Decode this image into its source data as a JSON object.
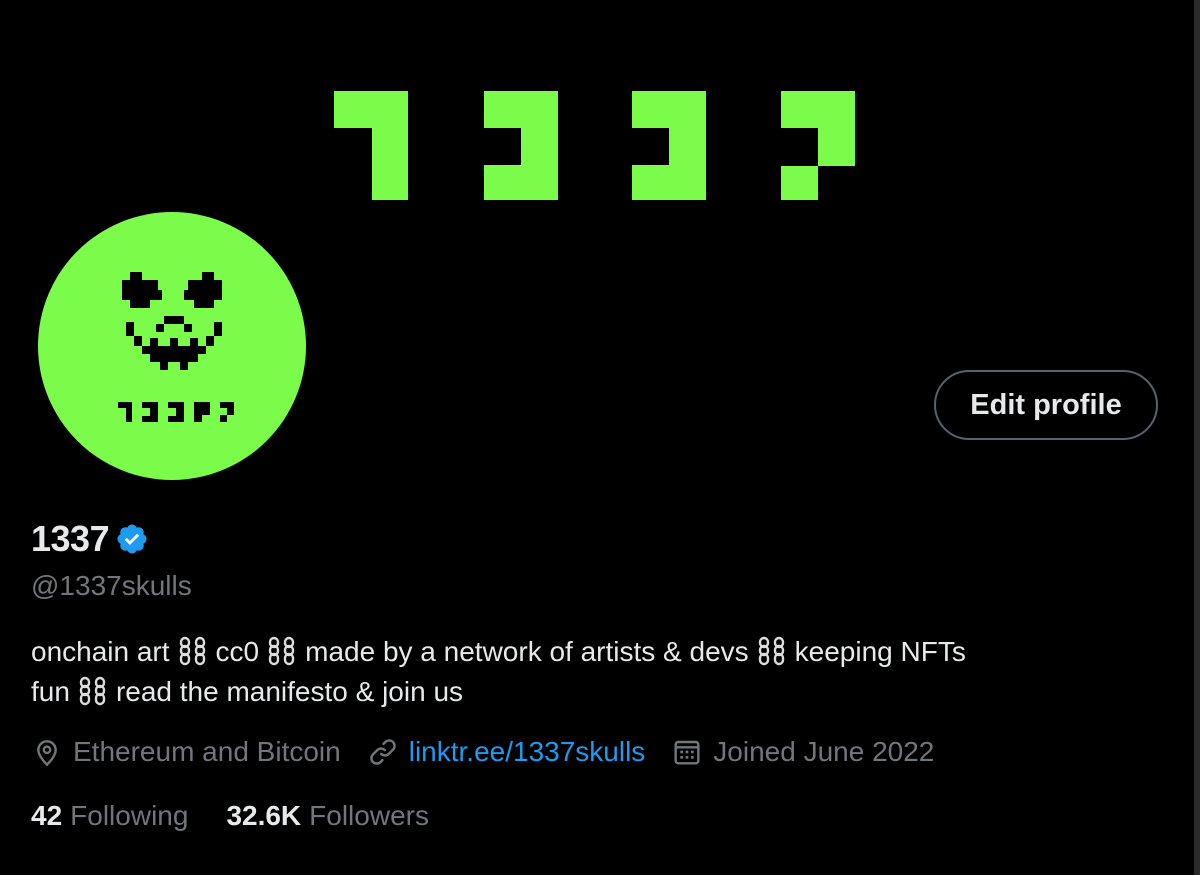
{
  "banner": {
    "logo_text": "1337"
  },
  "avatar": {
    "caption": "1337"
  },
  "actions": {
    "edit_profile_label": "Edit profile"
  },
  "profile": {
    "display_name": "1337",
    "handle": "@1337skulls",
    "verified": true,
    "bio": {
      "part1": "onchain art",
      "part2": "cc0",
      "part3": "made by a network of artists & devs",
      "part4": "keeping NFTs",
      "part5": "fun",
      "part6": "read the manifesto & join us"
    },
    "location": "Ethereum and Bitcoin",
    "website": "linktr.ee/1337skulls",
    "joined": "Joined June 2022"
  },
  "stats": {
    "following_count": "42",
    "following_label": "Following",
    "followers_count": "32.6K",
    "followers_label": "Followers"
  },
  "colors": {
    "background": "#000000",
    "accent_green": "#7cfc4a",
    "verified_blue": "#1d9bf0",
    "link_blue": "#1d9bf0",
    "muted_text": "#71767b"
  },
  "icons": [
    "verified-badge-icon",
    "location-pin-icon",
    "link-icon",
    "calendar-icon",
    "chain-link-emoji"
  ]
}
